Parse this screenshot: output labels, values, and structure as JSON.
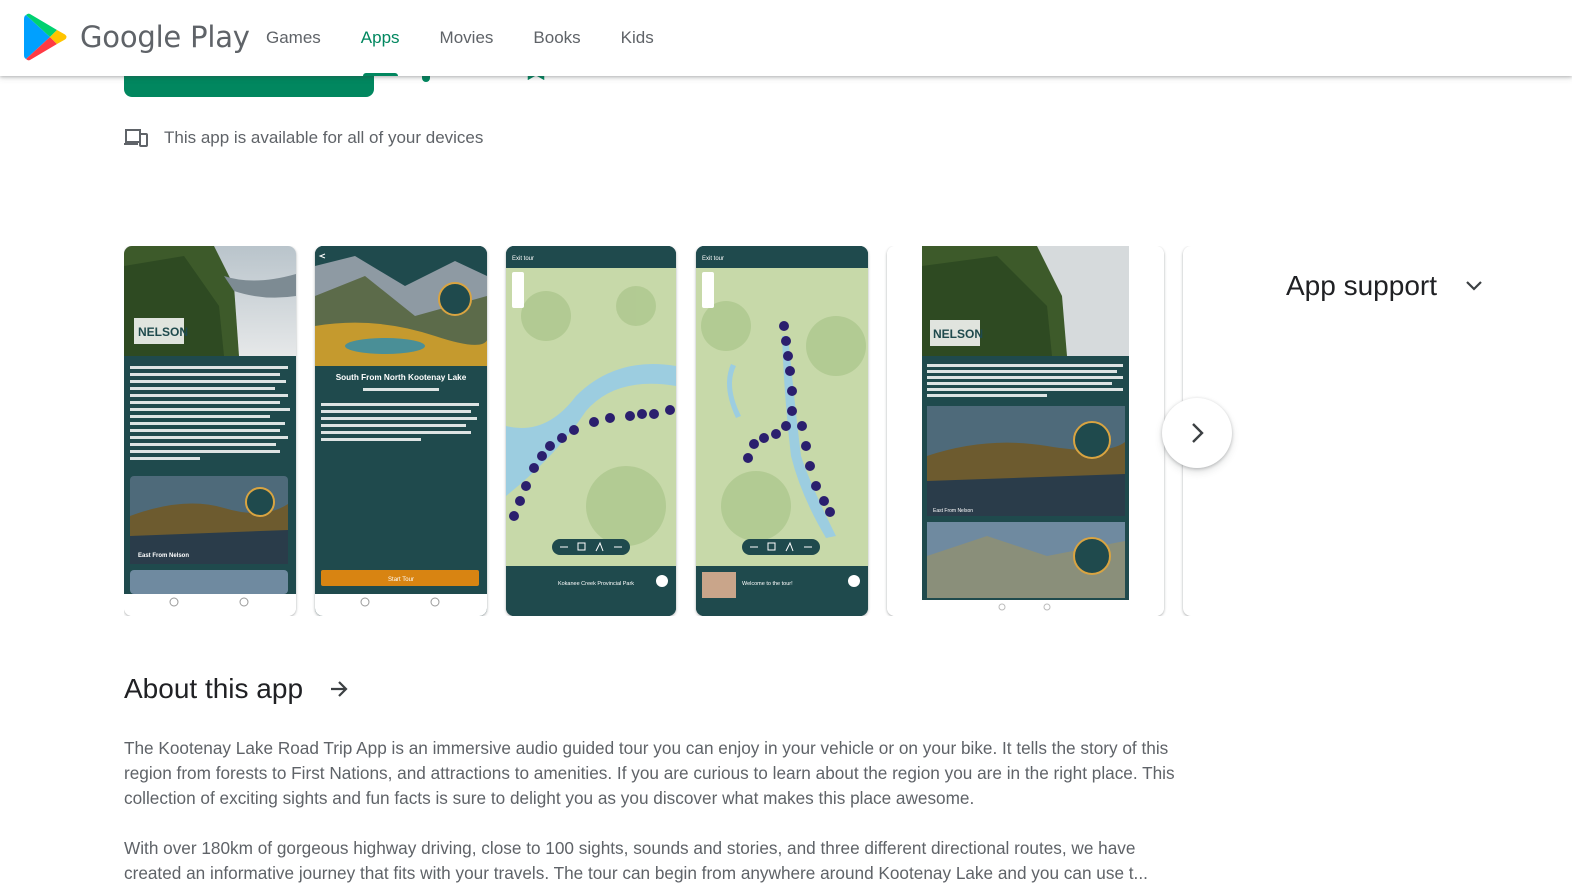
{
  "header": {
    "brand": "Google Play",
    "nav": [
      {
        "label": "Games",
        "active": false
      },
      {
        "label": "Apps",
        "active": true
      },
      {
        "label": "Movies",
        "active": false
      },
      {
        "label": "Books",
        "active": false
      },
      {
        "label": "Kids",
        "active": false
      }
    ]
  },
  "devices_note": "This app is available for all of your devices",
  "screenshots": {
    "shot1": {
      "badge": "NELSON",
      "caption": "East From Nelson"
    },
    "shot2": {
      "title": "South From North Kootenay Lake",
      "button": "Start Tour"
    },
    "shot3": {
      "topbar": "Exit tour",
      "footer": "Kokanee Creek Provincial Park"
    },
    "shot4": {
      "topbar": "Exit tour",
      "footer": "Welcome to the tour!"
    },
    "shot5": {
      "badge": "NELSON",
      "caption": "East From Nelson"
    }
  },
  "support": {
    "label": "App support"
  },
  "about": {
    "title": "About this app",
    "p1": "The Kootenay Lake Road Trip App is an immersive audio guided tour you can enjoy in your vehicle or on your bike. It tells the story of this region from forests to First Nations, and attractions to amenities. If you are curious to learn about the region you are in the right place. This collection of exciting sights and fun facts is sure to delight you as you discover what makes this place awesome.",
    "p2_line1": "With over 180km of gorgeous highway driving, close to 100 sights, sounds and stories, and three different directional routes, we have",
    "p2_line2": "created an informative journey that fits with your travels. The tour can begin from anywhere around Kootenay Lake and you can use t..."
  },
  "colors": {
    "accent": "#01875f",
    "teal": "#1f4a4d",
    "orange": "#d88412"
  }
}
